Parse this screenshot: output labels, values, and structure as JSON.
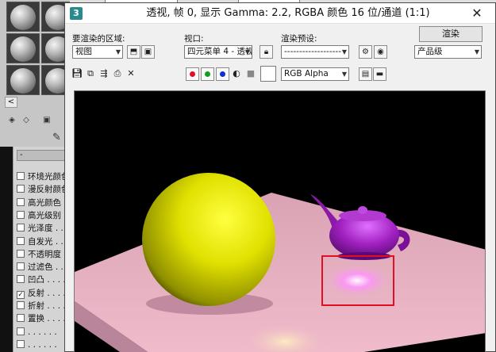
{
  "window": {
    "title": "透视, 帧 0, 显示 Gamma: 2.2, RGBA 颜色 16 位/通道 (1:1)",
    "close_glyph": "✕"
  },
  "controls": {
    "area_label": "要渲染的区域:",
    "area_value": "视图",
    "viewport_label": "视口:",
    "viewport_value": "四元菜单 4 - 透视",
    "preset_label": "渲染预设:",
    "preset_value": "-------------------",
    "render_button": "渲染",
    "quality_value": "产品级",
    "channel_value": "RGB Alpha"
  },
  "channels": {
    "red": "#e01020",
    "green": "#10a020",
    "blue": "#1030d0"
  },
  "left_panel": {
    "rollout_label": "-",
    "maps": [
      {
        "label": "环境光颜色",
        "checked": false
      },
      {
        "label": "漫反射颜色",
        "checked": false
      },
      {
        "label": "高光颜色 . .",
        "checked": false
      },
      {
        "label": "高光级别 . .",
        "checked": false
      },
      {
        "label": "光泽度 . . .",
        "checked": false
      },
      {
        "label": "自发光 . . .",
        "checked": false
      },
      {
        "label": "不透明度 . .",
        "checked": false
      },
      {
        "label": "过滤色 . . .",
        "checked": false
      },
      {
        "label": "凹凸 . . . .",
        "checked": false
      },
      {
        "label": "反射 . . . .",
        "checked": true
      },
      {
        "label": "折射 . . . .",
        "checked": false
      },
      {
        "label": "置换 . . . .",
        "checked": false
      },
      {
        "label": ". . . . . .",
        "checked": false
      },
      {
        "label": ". . . . . .",
        "checked": false
      }
    ]
  },
  "scene": {
    "table_color": "#e8b4c4",
    "sphere_color": "#e6e600",
    "teapot_color": "#a020c0",
    "background": "#000000",
    "selection_color": "#e01020"
  }
}
